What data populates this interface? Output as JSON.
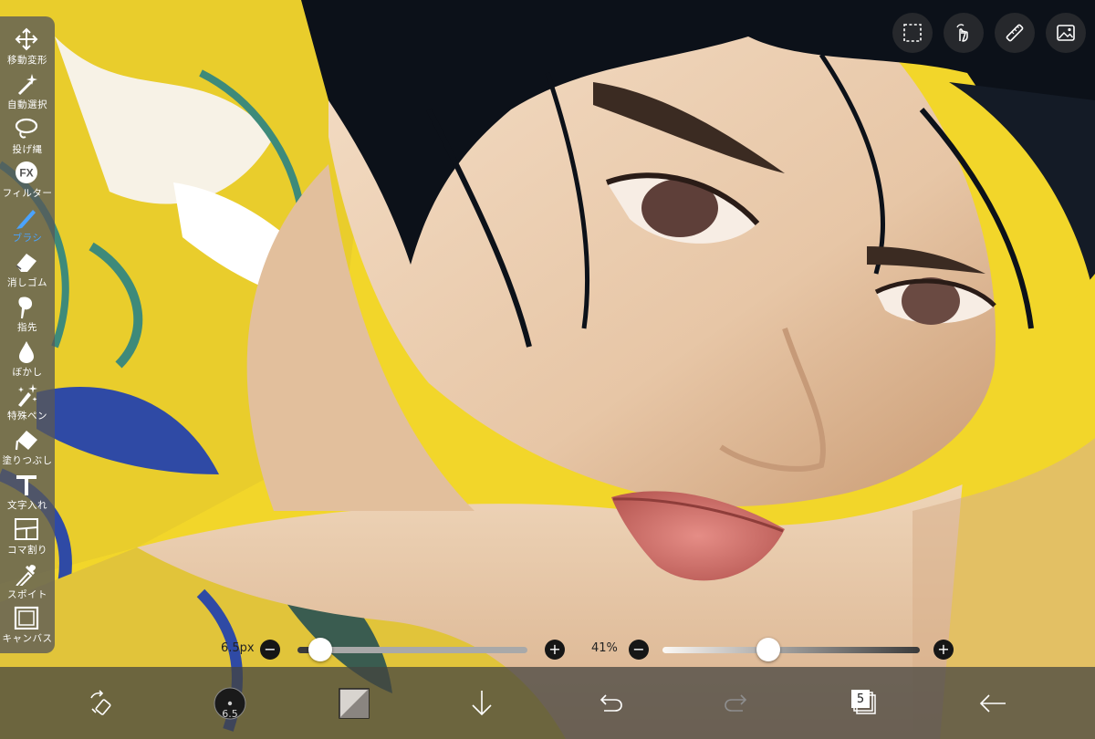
{
  "tools": [
    {
      "key": "move",
      "label": "移動変形",
      "icon": "move-arrows-icon"
    },
    {
      "key": "magic",
      "label": "自動選択",
      "icon": "magic-wand-icon"
    },
    {
      "key": "lasso",
      "label": "投げ縄",
      "icon": "lasso-icon"
    },
    {
      "key": "filter",
      "label": "フィルター",
      "icon": "fx-icon"
    },
    {
      "key": "brush",
      "label": "ブラシ",
      "icon": "brush-icon",
      "active": true
    },
    {
      "key": "eraser",
      "label": "消しゴム",
      "icon": "eraser-icon"
    },
    {
      "key": "smudge",
      "label": "指先",
      "icon": "finger-smudge-icon"
    },
    {
      "key": "blur",
      "label": "ぼかし",
      "icon": "droplet-icon"
    },
    {
      "key": "special",
      "label": "特殊ペン",
      "icon": "sparkle-pen-icon"
    },
    {
      "key": "fill",
      "label": "塗りつぶし",
      "icon": "paint-bucket-icon"
    },
    {
      "key": "text",
      "label": "文字入れ",
      "icon": "text-t-icon"
    },
    {
      "key": "frame",
      "label": "コマ割り",
      "icon": "panel-divider-icon"
    },
    {
      "key": "eyedropper",
      "label": "スポイト",
      "icon": "eyedropper-icon"
    },
    {
      "key": "canvas",
      "label": "キャンバス",
      "icon": "canvas-icon"
    }
  ],
  "top_buttons": [
    "selection-icon",
    "hand-touch-icon",
    "ruler-icon",
    "image-reference-icon"
  ],
  "brush_size": {
    "value_label": "6.5px",
    "level": 0.1
  },
  "opacity": {
    "value_label": "41%",
    "level": 0.41
  },
  "bottom": {
    "brush_size_badge": "6.5",
    "layers_count": "5",
    "icons": [
      "swap-color-icon",
      "brush-size-icon",
      "color-swatch-icon",
      "download-arrow-icon",
      "undo-icon",
      "redo-icon",
      "layers-icon",
      "back-arrow-icon"
    ]
  },
  "colors": {
    "accent": "#4aa3ff",
    "toolbar": "#585858",
    "background": "#f2d62a"
  }
}
